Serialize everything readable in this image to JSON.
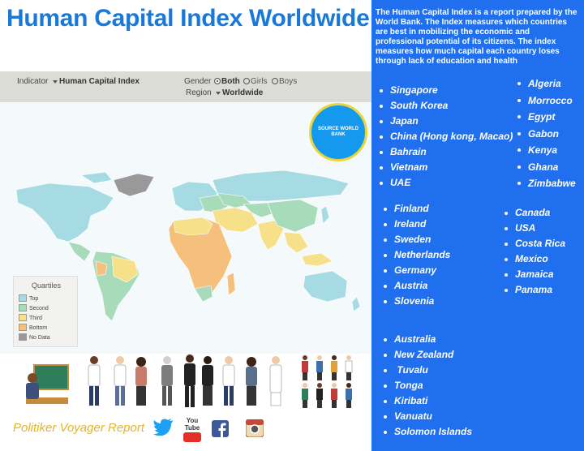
{
  "title": "Human Capital Index Worldwide",
  "filters": {
    "indicator_label": "Indicator",
    "indicator_value": "Human Capital Index",
    "gender_label": "Gender",
    "gender_options": [
      "Both",
      "Girls",
      "Boys"
    ],
    "gender_selected": "Both",
    "region_label": "Region",
    "region_value": "Worldwide"
  },
  "source_badge": "SOURCE WORLD BANK",
  "legend": {
    "title": "Quartiles",
    "items": [
      {
        "label": "Top",
        "color": "#a7dbe3"
      },
      {
        "label": "Second",
        "color": "#a8dbb9"
      },
      {
        "label": "Third",
        "color": "#f6e08a"
      },
      {
        "label": "Bottom",
        "color": "#f5c07c"
      },
      {
        "label": "No Data",
        "color": "#999999"
      }
    ]
  },
  "report_label": "Politiker Voyager Report",
  "social_icons": [
    "twitter-icon",
    "youtube-icon",
    "facebook-icon",
    "instagram-icon"
  ],
  "youtube_text": "You Tube",
  "description": "The Human Capital Index is a report prepared by the World Bank. The Index measures which countries are best in mobilizing the economic and professional potential of its citizens. The index measures how much capital each country loses through lack of education and health",
  "groups": {
    "asia": [
      "Singapore",
      "South Korea",
      "Japan",
      "China (Hong kong, Macao)",
      "Bahrain",
      "Vietnam",
      "UAE"
    ],
    "africa": [
      "Algeria",
      "Morrocco",
      "Egypt",
      "Gabon",
      "Kenya",
      "Ghana",
      "Zimbabwe"
    ],
    "europe": [
      "Finland",
      "Ireland",
      "Sweden",
      "Netherlands",
      "Germany",
      "Austria",
      "Slovenia"
    ],
    "americas": [
      "Canada",
      "USA",
      "Costa Rica",
      "Mexico",
      "Jamaica",
      "Panama"
    ],
    "oceania": [
      "Australia",
      "New Zealand",
      " Tuvalu",
      "Tonga",
      "Kiribati",
      "Vanuatu",
      "Solomon Islands"
    ]
  },
  "colors": {
    "title": "#1a78d8",
    "panel": "#1f6fef",
    "report": "#e4b52a",
    "badge": "#1499ee"
  }
}
